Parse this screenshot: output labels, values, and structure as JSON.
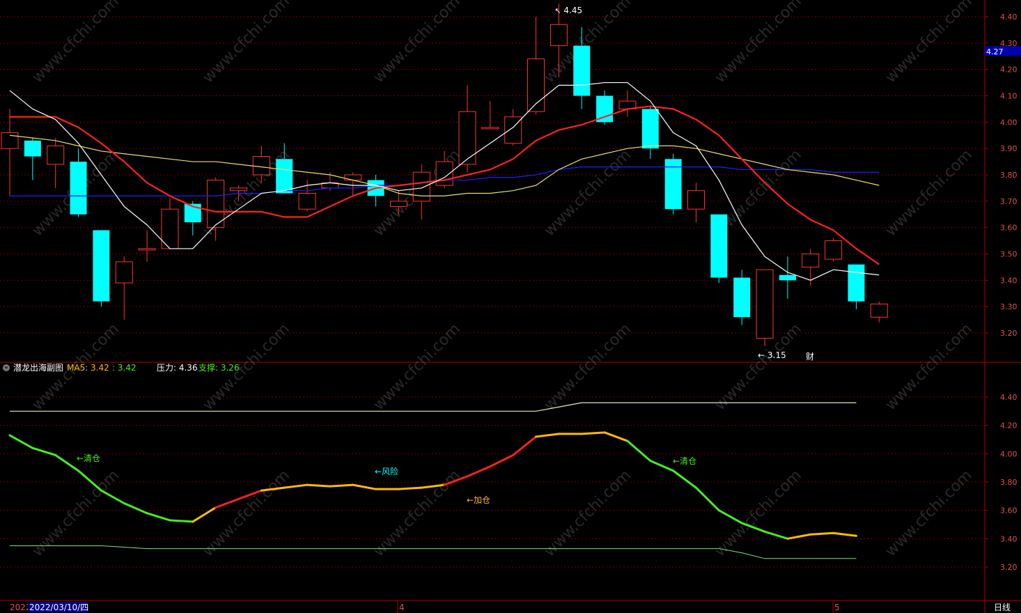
{
  "colors": {
    "up": "#ff3333",
    "down": "#00ffff",
    "axis": "#b00000",
    "grid": "#7a0000",
    "price_label": "#e05050",
    "ma_white": "#ffffff",
    "ma_red": "#ff2020",
    "ma_yellow": "#e8e070",
    "ma_blue": "#2020ff",
    "sub_green": "#44ee22",
    "sub_orange": "#ffbb00",
    "sub_red": "#ff2020",
    "sub_upper": "#e8e8c0",
    "sub_lower": "#88dd88"
  },
  "main": {
    "y_ticks": [
      "4.40",
      "4.30",
      "4.20",
      "4.10",
      "4.00",
      "3.90",
      "3.80",
      "3.70",
      "3.60",
      "3.50",
      "3.40",
      "3.30",
      "3.20"
    ],
    "current_price": "4.27",
    "high_label": "4.45",
    "low_label": "3.15",
    "event_label": "财"
  },
  "sub": {
    "indicator_name": "潜龙出海副图",
    "ma5_label": "MA5: 3.42",
    "ma5_second": ": 3.42",
    "pressure_label": "压力: 4.36",
    "support_label": "支撑: 3.26",
    "y_ticks": [
      "4.40",
      "4.20",
      "4.00",
      "3.80",
      "3.60",
      "3.40",
      "3.20"
    ],
    "annotations": {
      "clear1": "←清仓",
      "risk": "←风险",
      "add": "←加仓",
      "clear2": "←清仓"
    }
  },
  "bottom": {
    "date_prefix": "2022",
    "date_label": "2022/03/10/四",
    "month_4": "4",
    "month_5": "5",
    "period": "日线"
  },
  "watermark": "www.cfchi.com",
  "chart_data": {
    "type": "candlestick",
    "ylim": [
      3.12,
      4.48
    ],
    "candles": [
      {
        "o": 3.9,
        "h": 4.05,
        "l": 3.72,
        "c": 3.96
      },
      {
        "o": 3.93,
        "h": 3.94,
        "l": 3.78,
        "c": 3.87
      },
      {
        "o": 3.84,
        "h": 3.94,
        "l": 3.75,
        "c": 3.91
      },
      {
        "o": 3.85,
        "h": 3.9,
        "l": 3.64,
        "c": 3.65
      },
      {
        "o": 3.59,
        "h": 3.59,
        "l": 3.3,
        "c": 3.32
      },
      {
        "o": 3.39,
        "h": 3.49,
        "l": 3.25,
        "c": 3.47
      },
      {
        "o": 3.52,
        "h": 3.59,
        "l": 3.47,
        "c": 3.52
      },
      {
        "o": 3.52,
        "h": 3.71,
        "l": 3.52,
        "c": 3.67
      },
      {
        "o": 3.69,
        "h": 3.7,
        "l": 3.57,
        "c": 3.62
      },
      {
        "o": 3.6,
        "h": 3.79,
        "l": 3.55,
        "c": 3.78
      },
      {
        "o": 3.74,
        "h": 3.76,
        "l": 3.7,
        "c": 3.75
      },
      {
        "o": 3.8,
        "h": 3.91,
        "l": 3.77,
        "c": 3.87
      },
      {
        "o": 3.86,
        "h": 3.92,
        "l": 3.73,
        "c": 3.73
      },
      {
        "o": 3.67,
        "h": 3.78,
        "l": 3.66,
        "c": 3.73
      },
      {
        "o": 3.75,
        "h": 3.81,
        "l": 3.74,
        "c": 3.77
      },
      {
        "o": 3.78,
        "h": 3.81,
        "l": 3.72,
        "c": 3.8
      },
      {
        "o": 3.78,
        "h": 3.8,
        "l": 3.68,
        "c": 3.72
      },
      {
        "o": 3.68,
        "h": 3.74,
        "l": 3.65,
        "c": 3.7
      },
      {
        "o": 3.7,
        "h": 3.84,
        "l": 3.63,
        "c": 3.81
      },
      {
        "o": 3.76,
        "h": 3.89,
        "l": 3.75,
        "c": 3.85
      },
      {
        "o": 3.84,
        "h": 4.14,
        "l": 3.81,
        "c": 4.04
      },
      {
        "o": 3.98,
        "h": 4.08,
        "l": 3.98,
        "c": 3.98
      },
      {
        "o": 3.92,
        "h": 4.05,
        "l": 3.91,
        "c": 4.02
      },
      {
        "o": 4.04,
        "h": 4.4,
        "l": 4.03,
        "c": 4.24
      },
      {
        "o": 4.29,
        "h": 4.45,
        "l": 4.17,
        "c": 4.37
      },
      {
        "o": 4.29,
        "h": 4.36,
        "l": 4.05,
        "c": 4.1
      },
      {
        "o": 4.1,
        "h": 4.12,
        "l": 3.99,
        "c": 4.0
      },
      {
        "o": 4.05,
        "h": 4.12,
        "l": 4.02,
        "c": 4.08
      },
      {
        "o": 4.05,
        "h": 4.06,
        "l": 3.86,
        "c": 3.9
      },
      {
        "o": 3.86,
        "h": 3.88,
        "l": 3.65,
        "c": 3.67
      },
      {
        "o": 3.67,
        "h": 3.77,
        "l": 3.62,
        "c": 3.74
      },
      {
        "o": 3.65,
        "h": 3.65,
        "l": 3.39,
        "c": 3.41
      },
      {
        "o": 3.41,
        "h": 3.44,
        "l": 3.23,
        "c": 3.26
      },
      {
        "o": 3.18,
        "h": 3.44,
        "l": 3.15,
        "c": 3.44
      },
      {
        "o": 3.42,
        "h": 3.49,
        "l": 3.33,
        "c": 3.4
      },
      {
        "o": 3.45,
        "h": 3.52,
        "l": 3.38,
        "c": 3.5
      },
      {
        "o": 3.48,
        "h": 3.56,
        "l": 3.47,
        "c": 3.55
      },
      {
        "o": 3.46,
        "h": 3.46,
        "l": 3.29,
        "c": 3.32
      },
      {
        "o": 3.26,
        "h": 3.32,
        "l": 3.24,
        "c": 3.31
      }
    ],
    "ma_white": [
      4.12,
      4.05,
      4.01,
      3.92,
      3.8,
      3.68,
      3.61,
      3.52,
      3.52,
      3.61,
      3.67,
      3.73,
      3.74,
      3.76,
      3.77,
      3.76,
      3.76,
      3.74,
      3.75,
      3.79,
      3.86,
      3.92,
      3.98,
      4.07,
      4.14,
      4.14,
      4.15,
      4.15,
      4.08,
      3.96,
      3.91,
      3.78,
      3.61,
      3.49,
      3.43,
      3.4,
      3.44,
      3.43,
      3.42
    ],
    "ma_red": [
      4.02,
      4.02,
      4.02,
      3.98,
      3.92,
      3.85,
      3.77,
      3.72,
      3.68,
      3.66,
      3.66,
      3.66,
      3.64,
      3.64,
      3.68,
      3.72,
      3.75,
      3.76,
      3.77,
      3.78,
      3.8,
      3.82,
      3.86,
      3.93,
      3.97,
      3.99,
      4.02,
      4.05,
      4.06,
      4.05,
      4.01,
      3.95,
      3.86,
      3.77,
      3.69,
      3.63,
      3.59,
      3.52,
      3.46
    ],
    "ma_yellow": [
      3.95,
      3.94,
      3.93,
      3.91,
      3.89,
      3.88,
      3.87,
      3.86,
      3.85,
      3.85,
      3.84,
      3.83,
      3.82,
      3.81,
      3.8,
      3.78,
      3.76,
      3.73,
      3.72,
      3.72,
      3.73,
      3.73,
      3.74,
      3.76,
      3.82,
      3.86,
      3.88,
      3.9,
      3.91,
      3.91,
      3.9,
      3.88,
      3.86,
      3.84,
      3.82,
      3.81,
      3.8,
      3.78,
      3.76
    ],
    "ma_blue": [
      3.72,
      3.72,
      3.72,
      3.72,
      3.72,
      3.72,
      3.72,
      3.72,
      3.72,
      3.72,
      3.73,
      3.73,
      3.74,
      3.74,
      3.75,
      3.75,
      3.76,
      3.76,
      3.77,
      3.78,
      3.78,
      3.79,
      3.79,
      3.8,
      3.82,
      3.83,
      3.83,
      3.83,
      3.83,
      3.83,
      3.83,
      3.83,
      3.82,
      3.82,
      3.82,
      3.82,
      3.81,
      3.81,
      3.81
    ],
    "sub_ylim": [
      3.1,
      4.6
    ],
    "sub_ma5": [
      4.13,
      4.04,
      3.99,
      3.88,
      3.74,
      3.65,
      3.58,
      3.53,
      3.52,
      3.62,
      3.68,
      3.74,
      3.76,
      3.78,
      3.77,
      3.78,
      3.75,
      3.75,
      3.76,
      3.78,
      3.84,
      3.91,
      3.99,
      4.12,
      4.14,
      4.14,
      4.15,
      4.09,
      3.95,
      3.88,
      3.76,
      3.6,
      3.51,
      3.45,
      3.4,
      3.43,
      3.44,
      3.42
    ],
    "sub_ma5_color": [
      "g",
      "g",
      "g",
      "g",
      "g",
      "g",
      "g",
      "g",
      "o",
      "r",
      "r",
      "o",
      "o",
      "o",
      "o",
      "o",
      "o",
      "o",
      "o",
      "r",
      "r",
      "r",
      "r",
      "o",
      "o",
      "o",
      "o",
      "g",
      "g",
      "g",
      "g",
      "g",
      "g",
      "g",
      "o",
      "o",
      "o",
      "o"
    ],
    "sub_pressure": [
      4.3,
      4.3,
      4.3,
      4.3,
      4.3,
      4.3,
      4.3,
      4.3,
      4.3,
      4.3,
      4.3,
      4.3,
      4.3,
      4.3,
      4.3,
      4.3,
      4.3,
      4.3,
      4.3,
      4.3,
      4.3,
      4.3,
      4.3,
      4.3,
      4.33,
      4.36,
      4.36,
      4.36,
      4.36,
      4.36,
      4.36,
      4.36,
      4.36,
      4.36,
      4.36,
      4.36,
      4.36,
      4.36
    ],
    "sub_support": [
      3.35,
      3.35,
      3.35,
      3.35,
      3.35,
      3.34,
      3.33,
      3.33,
      3.33,
      3.33,
      3.33,
      3.33,
      3.33,
      3.33,
      3.33,
      3.33,
      3.33,
      3.33,
      3.33,
      3.33,
      3.33,
      3.33,
      3.33,
      3.33,
      3.33,
      3.33,
      3.33,
      3.33,
      3.33,
      3.33,
      3.33,
      3.33,
      3.3,
      3.26,
      3.26,
      3.26,
      3.26,
      3.26
    ]
  }
}
